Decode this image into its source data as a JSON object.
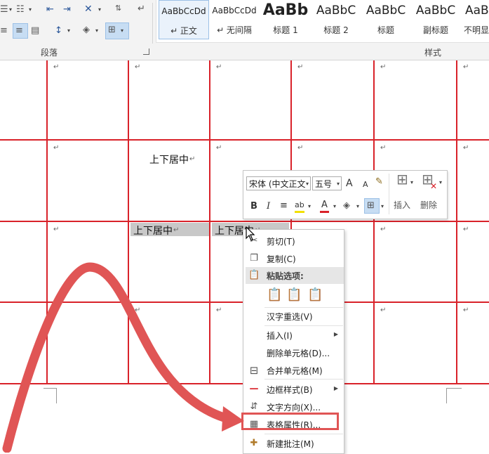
{
  "ribbon": {
    "paragraph_group_label": "段落",
    "styles_group_label": "样式",
    "styles": [
      {
        "sample": "AaBbCcDd",
        "name": "↵ 正文",
        "selected": true
      },
      {
        "sample": "AaBbCcDd",
        "name": "↵ 无间隔",
        "selected": false
      },
      {
        "sample": "AaBb",
        "name": "标题 1",
        "selected": false
      },
      {
        "sample": "AaBbC",
        "name": "标题 2",
        "selected": false
      },
      {
        "sample": "AaBbC",
        "name": "标题",
        "selected": false
      },
      {
        "sample": "AaBbC",
        "name": "副标题",
        "selected": false
      },
      {
        "sample": "AaBbC",
        "name": "不明显",
        "selected": false
      }
    ]
  },
  "document": {
    "paragraph_mark": "↵",
    "cell_texts": {
      "row2_col3": "上下居中",
      "row3_col3": "上下居中",
      "row3_col4": "上下居中"
    },
    "line_color": "#d9222a"
  },
  "mini_toolbar": {
    "font_name": "宋体 (中文正文",
    "font_size": "五号",
    "grow_font_label": "A",
    "shrink_font_label": "A",
    "bold_label": "B",
    "italic_label": "I",
    "font_color_label": "A",
    "insert_label": "插入",
    "delete_label": "删除"
  },
  "context_menu": {
    "items": [
      {
        "label": "剪切(T)",
        "icon": "scissors-icon"
      },
      {
        "label": "复制(C)",
        "icon": "copy-icon"
      },
      {
        "label": "粘贴选项:",
        "icon": "paste-icon"
      },
      {
        "label": "汉字重选(V)",
        "icon": ""
      },
      {
        "label": "插入(I)",
        "icon": "",
        "submenu": true
      },
      {
        "label": "删除单元格(D)...",
        "icon": ""
      },
      {
        "label": "合并单元格(M)",
        "icon": "merge-cells-icon"
      },
      {
        "label": "边框样式(B)",
        "icon": "border-style-icon",
        "submenu": true
      },
      {
        "label": "文字方向(X)...",
        "icon": "text-direction-icon"
      },
      {
        "label": "表格属性(R)...",
        "icon": "table-properties-icon",
        "highlighted": true
      },
      {
        "label": "新建批注(M)",
        "icon": "new-comment-icon"
      }
    ],
    "submenu_arrow": "▶"
  },
  "annotation": {
    "arrow_color": "#e05555"
  }
}
